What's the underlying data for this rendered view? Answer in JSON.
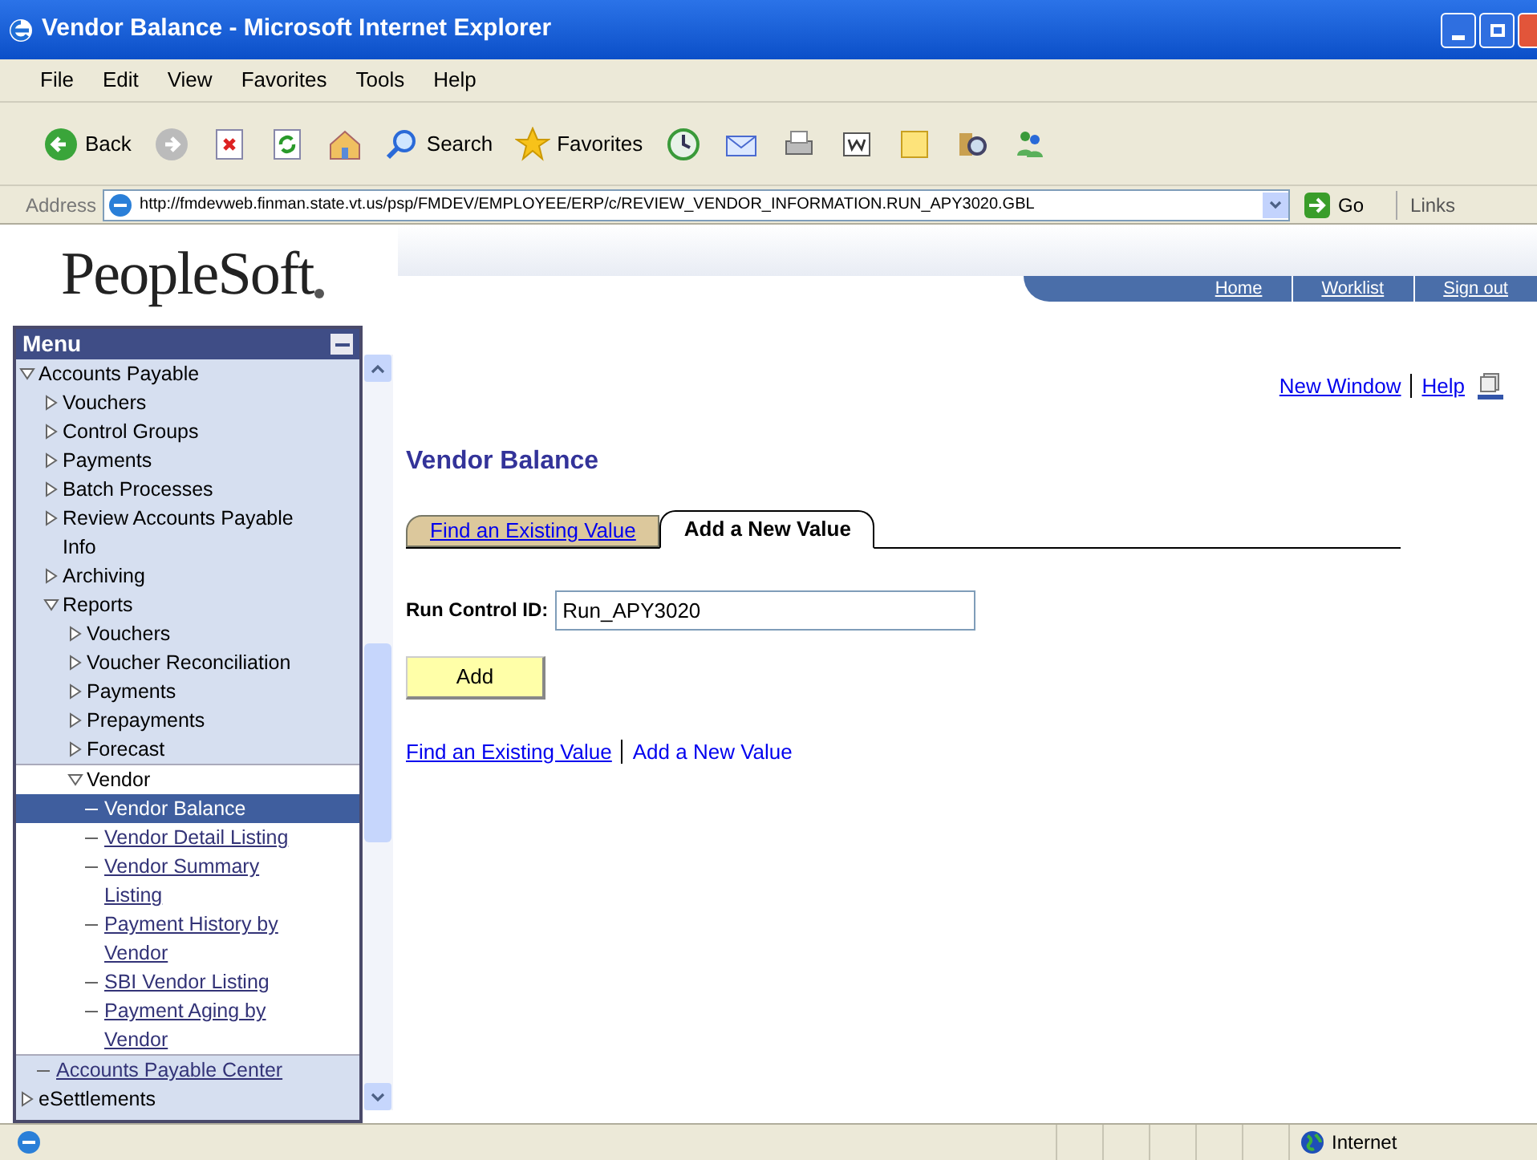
{
  "window": {
    "title": "Vendor Balance - Microsoft Internet Explorer"
  },
  "menu_bar": [
    "File",
    "Edit",
    "View",
    "Favorites",
    "Tools",
    "Help"
  ],
  "toolbar": [
    {
      "kind": "back",
      "label": "Back"
    },
    {
      "kind": "forward"
    },
    {
      "kind": "stop"
    },
    {
      "kind": "refresh"
    },
    {
      "kind": "home"
    },
    {
      "kind": "search",
      "label": "Search"
    },
    {
      "kind": "favorites",
      "label": "Favorites"
    },
    {
      "kind": "history"
    },
    {
      "kind": "mail"
    },
    {
      "kind": "print"
    },
    {
      "kind": "edit"
    },
    {
      "kind": "note"
    },
    {
      "kind": "research"
    },
    {
      "kind": "messenger"
    }
  ],
  "address_bar": {
    "label": "Address",
    "url": "http://fmdevweb.finman.state.vt.us/psp/FMDEV/EMPLOYEE/ERP/c/REVIEW_VENDOR_INFORMATION.RUN_APY3020.GBL",
    "go": "Go",
    "links": "Links"
  },
  "header": {
    "logo": "PeopleSoft",
    "links": [
      "Home",
      "Worklist",
      "Sign out"
    ]
  },
  "menu": {
    "title": "Menu",
    "items": [
      {
        "kind": "folder",
        "label": "Accounts Payable",
        "expanded": true,
        "children": [
          {
            "kind": "folder",
            "label": "Vouchers",
            "expanded": false
          },
          {
            "kind": "folder",
            "label": "Control Groups",
            "expanded": false
          },
          {
            "kind": "folder",
            "label": "Payments",
            "expanded": false
          },
          {
            "kind": "folder",
            "label": "Batch Processes",
            "expanded": false
          },
          {
            "kind": "folder",
            "label": "Review Accounts Payable Info",
            "expanded": false
          },
          {
            "kind": "folder",
            "label": "Archiving",
            "expanded": false
          },
          {
            "kind": "folder",
            "label": "Reports",
            "expanded": true,
            "children": [
              {
                "kind": "folder",
                "label": "Vouchers",
                "expanded": false
              },
              {
                "kind": "folder",
                "label": "Voucher Reconciliation",
                "expanded": false
              },
              {
                "kind": "folder",
                "label": "Payments",
                "expanded": false
              },
              {
                "kind": "folder",
                "label": "Prepayments",
                "expanded": false
              },
              {
                "kind": "folder",
                "label": "Forecast",
                "expanded": false
              },
              {
                "kind": "folder",
                "label": "Vendor",
                "expanded": true,
                "current": true,
                "children": [
                  {
                    "kind": "link",
                    "label": "Vendor Balance",
                    "selected": true
                  },
                  {
                    "kind": "link",
                    "label": "Vendor Detail Listing",
                    "selected": false
                  },
                  {
                    "kind": "link",
                    "label": "Vendor Summary Listing",
                    "selected": false
                  },
                  {
                    "kind": "link",
                    "label": "Payment History by Vendor",
                    "selected": false
                  },
                  {
                    "kind": "link",
                    "label": "SBI Vendor Listing",
                    "selected": false
                  },
                  {
                    "kind": "link",
                    "label": "Payment Aging by Vendor",
                    "selected": false
                  }
                ]
              }
            ]
          },
          {
            "kind": "link",
            "label": "Accounts Payable Center",
            "selected": false
          }
        ]
      },
      {
        "kind": "folder",
        "label": "eSettlements",
        "expanded": false
      }
    ]
  },
  "content": {
    "top_links": [
      "New Window",
      "Help"
    ],
    "title": "Vendor Balance",
    "tabs": [
      {
        "label": "Find an Existing Value",
        "selected": false
      },
      {
        "label": "Add a New Value",
        "selected": true
      }
    ],
    "field": {
      "label": "Run Control ID:",
      "value": "Run_APY3020"
    },
    "button": "Add",
    "bottom_links": [
      "Find an Existing Value",
      "Add a New Value"
    ]
  },
  "status_bar": {
    "zone": "Internet"
  }
}
